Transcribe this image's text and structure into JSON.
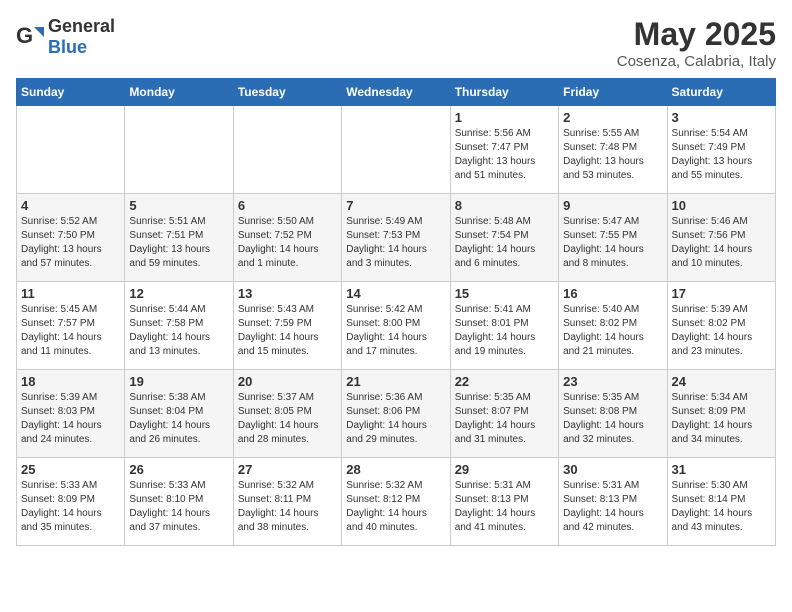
{
  "header": {
    "logo_general": "General",
    "logo_blue": "Blue",
    "title": "May 2025",
    "subtitle": "Cosenza, Calabria, Italy"
  },
  "days_of_week": [
    "Sunday",
    "Monday",
    "Tuesday",
    "Wednesday",
    "Thursday",
    "Friday",
    "Saturday"
  ],
  "weeks": [
    [
      {
        "day": "",
        "sunrise": "",
        "sunset": "",
        "daylight": ""
      },
      {
        "day": "",
        "sunrise": "",
        "sunset": "",
        "daylight": ""
      },
      {
        "day": "",
        "sunrise": "",
        "sunset": "",
        "daylight": ""
      },
      {
        "day": "",
        "sunrise": "",
        "sunset": "",
        "daylight": ""
      },
      {
        "day": "1",
        "sunrise": "Sunrise: 5:56 AM",
        "sunset": "Sunset: 7:47 PM",
        "daylight": "Daylight: 13 hours and 51 minutes."
      },
      {
        "day": "2",
        "sunrise": "Sunrise: 5:55 AM",
        "sunset": "Sunset: 7:48 PM",
        "daylight": "Daylight: 13 hours and 53 minutes."
      },
      {
        "day": "3",
        "sunrise": "Sunrise: 5:54 AM",
        "sunset": "Sunset: 7:49 PM",
        "daylight": "Daylight: 13 hours and 55 minutes."
      }
    ],
    [
      {
        "day": "4",
        "sunrise": "Sunrise: 5:52 AM",
        "sunset": "Sunset: 7:50 PM",
        "daylight": "Daylight: 13 hours and 57 minutes."
      },
      {
        "day": "5",
        "sunrise": "Sunrise: 5:51 AM",
        "sunset": "Sunset: 7:51 PM",
        "daylight": "Daylight: 13 hours and 59 minutes."
      },
      {
        "day": "6",
        "sunrise": "Sunrise: 5:50 AM",
        "sunset": "Sunset: 7:52 PM",
        "daylight": "Daylight: 14 hours and 1 minute."
      },
      {
        "day": "7",
        "sunrise": "Sunrise: 5:49 AM",
        "sunset": "Sunset: 7:53 PM",
        "daylight": "Daylight: 14 hours and 3 minutes."
      },
      {
        "day": "8",
        "sunrise": "Sunrise: 5:48 AM",
        "sunset": "Sunset: 7:54 PM",
        "daylight": "Daylight: 14 hours and 6 minutes."
      },
      {
        "day": "9",
        "sunrise": "Sunrise: 5:47 AM",
        "sunset": "Sunset: 7:55 PM",
        "daylight": "Daylight: 14 hours and 8 minutes."
      },
      {
        "day": "10",
        "sunrise": "Sunrise: 5:46 AM",
        "sunset": "Sunset: 7:56 PM",
        "daylight": "Daylight: 14 hours and 10 minutes."
      }
    ],
    [
      {
        "day": "11",
        "sunrise": "Sunrise: 5:45 AM",
        "sunset": "Sunset: 7:57 PM",
        "daylight": "Daylight: 14 hours and 11 minutes."
      },
      {
        "day": "12",
        "sunrise": "Sunrise: 5:44 AM",
        "sunset": "Sunset: 7:58 PM",
        "daylight": "Daylight: 14 hours and 13 minutes."
      },
      {
        "day": "13",
        "sunrise": "Sunrise: 5:43 AM",
        "sunset": "Sunset: 7:59 PM",
        "daylight": "Daylight: 14 hours and 15 minutes."
      },
      {
        "day": "14",
        "sunrise": "Sunrise: 5:42 AM",
        "sunset": "Sunset: 8:00 PM",
        "daylight": "Daylight: 14 hours and 17 minutes."
      },
      {
        "day": "15",
        "sunrise": "Sunrise: 5:41 AM",
        "sunset": "Sunset: 8:01 PM",
        "daylight": "Daylight: 14 hours and 19 minutes."
      },
      {
        "day": "16",
        "sunrise": "Sunrise: 5:40 AM",
        "sunset": "Sunset: 8:02 PM",
        "daylight": "Daylight: 14 hours and 21 minutes."
      },
      {
        "day": "17",
        "sunrise": "Sunrise: 5:39 AM",
        "sunset": "Sunset: 8:02 PM",
        "daylight": "Daylight: 14 hours and 23 minutes."
      }
    ],
    [
      {
        "day": "18",
        "sunrise": "Sunrise: 5:39 AM",
        "sunset": "Sunset: 8:03 PM",
        "daylight": "Daylight: 14 hours and 24 minutes."
      },
      {
        "day": "19",
        "sunrise": "Sunrise: 5:38 AM",
        "sunset": "Sunset: 8:04 PM",
        "daylight": "Daylight: 14 hours and 26 minutes."
      },
      {
        "day": "20",
        "sunrise": "Sunrise: 5:37 AM",
        "sunset": "Sunset: 8:05 PM",
        "daylight": "Daylight: 14 hours and 28 minutes."
      },
      {
        "day": "21",
        "sunrise": "Sunrise: 5:36 AM",
        "sunset": "Sunset: 8:06 PM",
        "daylight": "Daylight: 14 hours and 29 minutes."
      },
      {
        "day": "22",
        "sunrise": "Sunrise: 5:35 AM",
        "sunset": "Sunset: 8:07 PM",
        "daylight": "Daylight: 14 hours and 31 minutes."
      },
      {
        "day": "23",
        "sunrise": "Sunrise: 5:35 AM",
        "sunset": "Sunset: 8:08 PM",
        "daylight": "Daylight: 14 hours and 32 minutes."
      },
      {
        "day": "24",
        "sunrise": "Sunrise: 5:34 AM",
        "sunset": "Sunset: 8:09 PM",
        "daylight": "Daylight: 14 hours and 34 minutes."
      }
    ],
    [
      {
        "day": "25",
        "sunrise": "Sunrise: 5:33 AM",
        "sunset": "Sunset: 8:09 PM",
        "daylight": "Daylight: 14 hours and 35 minutes."
      },
      {
        "day": "26",
        "sunrise": "Sunrise: 5:33 AM",
        "sunset": "Sunset: 8:10 PM",
        "daylight": "Daylight: 14 hours and 37 minutes."
      },
      {
        "day": "27",
        "sunrise": "Sunrise: 5:32 AM",
        "sunset": "Sunset: 8:11 PM",
        "daylight": "Daylight: 14 hours and 38 minutes."
      },
      {
        "day": "28",
        "sunrise": "Sunrise: 5:32 AM",
        "sunset": "Sunset: 8:12 PM",
        "daylight": "Daylight: 14 hours and 40 minutes."
      },
      {
        "day": "29",
        "sunrise": "Sunrise: 5:31 AM",
        "sunset": "Sunset: 8:13 PM",
        "daylight": "Daylight: 14 hours and 41 minutes."
      },
      {
        "day": "30",
        "sunrise": "Sunrise: 5:31 AM",
        "sunset": "Sunset: 8:13 PM",
        "daylight": "Daylight: 14 hours and 42 minutes."
      },
      {
        "day": "31",
        "sunrise": "Sunrise: 5:30 AM",
        "sunset": "Sunset: 8:14 PM",
        "daylight": "Daylight: 14 hours and 43 minutes."
      }
    ]
  ]
}
